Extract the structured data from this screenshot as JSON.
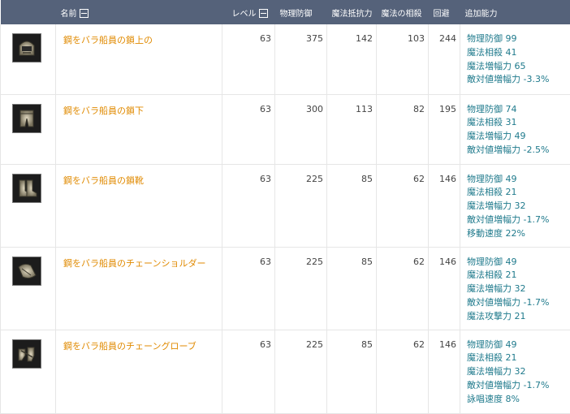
{
  "table": {
    "headers": {
      "name": "名前",
      "level": "レベル",
      "phys_def": "物理防御",
      "magic_res": "魔法抵抗力",
      "magic_cancel": "魔法の相殺",
      "evasion": "回避",
      "extra": "追加能力"
    },
    "sort_icons": [
      "collapse-square-icon",
      "collapse-square-icon"
    ],
    "rows": [
      {
        "icon": "chain-helmet-icon",
        "name": "鋼をバラ船員の鎖上の",
        "level": "63",
        "phys_def": "375",
        "magic_res": "142",
        "magic_cancel": "103",
        "evasion": "244",
        "extra": [
          "物理防御 99",
          "魔法相殺 41",
          "魔法増幅力 65",
          "敵対値増幅力 -3.3%"
        ]
      },
      {
        "icon": "chain-leggings-icon",
        "name": "鋼をバラ船員の鎖下",
        "level": "63",
        "phys_def": "300",
        "magic_res": "113",
        "magic_cancel": "82",
        "evasion": "195",
        "extra": [
          "物理防御 74",
          "魔法相殺 31",
          "魔法増幅力 49",
          "敵対値増幅力 -2.5%"
        ]
      },
      {
        "icon": "chain-boots-icon",
        "name": "鋼をバラ船員の鎖靴",
        "level": "63",
        "phys_def": "225",
        "magic_res": "85",
        "magic_cancel": "62",
        "evasion": "146",
        "extra": [
          "物理防御 49",
          "魔法相殺 21",
          "魔法増幅力 32",
          "敵対値増幅力 -1.7%",
          "移動速度 22%"
        ]
      },
      {
        "icon": "chain-shoulder-icon",
        "name": "鋼をバラ船員のチェーンショルダー",
        "level": "63",
        "phys_def": "225",
        "magic_res": "85",
        "magic_cancel": "62",
        "evasion": "146",
        "extra": [
          "物理防御 49",
          "魔法相殺 21",
          "魔法増幅力 32",
          "敵対値増幅力 -1.7%",
          "魔法攻撃力 21"
        ]
      },
      {
        "icon": "chain-gloves-icon",
        "name": "鋼をバラ船員のチェーングローブ",
        "level": "63",
        "phys_def": "225",
        "magic_res": "85",
        "magic_cancel": "62",
        "evasion": "146",
        "extra": [
          "物理防御 49",
          "魔法相殺 21",
          "魔法増幅力 32",
          "敵対値増幅力 -1.7%",
          "詠唱速度 8%"
        ]
      }
    ]
  },
  "colors": {
    "header_bg": "#55627a",
    "item_name": "#e08a00",
    "extra_stat": "#1f7a8c",
    "border": "#e6e6e6"
  }
}
